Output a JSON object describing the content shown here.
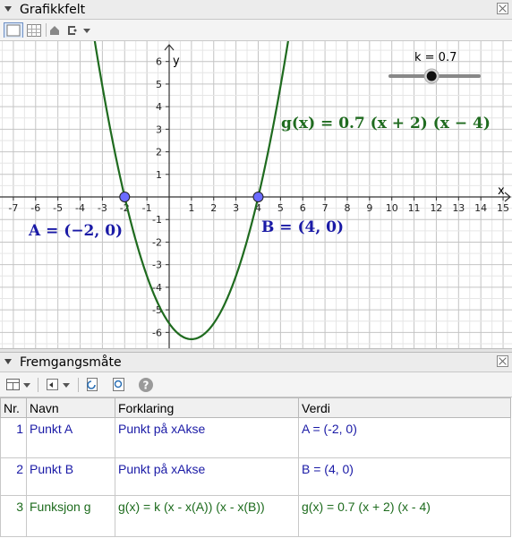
{
  "graphics_panel": {
    "title": "Grafikkfelt",
    "toolbar": {
      "icons": [
        "axes-toggle-icon",
        "grid-toggle-icon",
        "home-icon",
        "point-capture-icon",
        "dropdown-arrow-icon"
      ]
    },
    "slider": {
      "label": "k = 0.7",
      "value": 0.7,
      "min": 0,
      "max": 1.5
    },
    "function_label": "g(x) = 0.7 (x + 2) (x − 4)",
    "point_a_label": "A = (−2, 0)",
    "point_b_label": "B = (4, 0)",
    "x_axis_label": "x",
    "y_axis_label": "y",
    "colors": {
      "curve": "#1f6b1f",
      "point_fill": "#6b6bff",
      "point_label": "#1a1aa6",
      "grid": "#d2d2d2",
      "axis": "#333333"
    }
  },
  "chart_data": {
    "type": "line",
    "series": [
      {
        "name": "g(x) = 0.7 (x + 2) (x − 4)",
        "expression": "0.7*(x+2)*(x-4)",
        "k": 0.7
      }
    ],
    "points": [
      {
        "name": "A",
        "x": -2,
        "y": 0
      },
      {
        "name": "B",
        "x": 4,
        "y": 0
      }
    ],
    "xlim": [
      -7.6,
      15.4
    ],
    "ylim": [
      -6.7,
      6.9
    ],
    "x_ticks": [
      -7,
      -6,
      -5,
      -4,
      -3,
      -2,
      -1,
      1,
      2,
      3,
      4,
      5,
      6,
      7,
      8,
      9,
      10,
      11,
      12,
      13,
      14,
      15
    ],
    "y_ticks": [
      -6,
      -5,
      -4,
      -3,
      -2,
      -1,
      1,
      2,
      3,
      4,
      5,
      6
    ],
    "xlabel": "x",
    "ylabel": "y",
    "grid": true
  },
  "steps_panel": {
    "title": "Fremgangsmåte",
    "toolbar": {
      "icons": [
        "columns-icon",
        "dropdown-arrow-icon",
        "navigation-icon",
        "dropdown-arrow-icon",
        "refresh-icon",
        "print-preview-icon",
        "help-icon"
      ]
    },
    "columns": [
      "Nr.",
      "Navn",
      "Forklaring",
      "Verdi"
    ],
    "rows": [
      {
        "nr": "1",
        "name": "Punkt A",
        "explanation": "Punkt på xAkse",
        "value": "A = (-2, 0)"
      },
      {
        "nr": "2",
        "name": "Punkt B",
        "explanation": "Punkt på xAkse",
        "value": "B = (4, 0)"
      },
      {
        "nr": "3",
        "name": "Funksjon g",
        "explanation": "g(x) = k (x - x(A)) (x - x(B))",
        "value": "g(x) = 0.7 (x + 2) (x - 4)"
      }
    ]
  }
}
